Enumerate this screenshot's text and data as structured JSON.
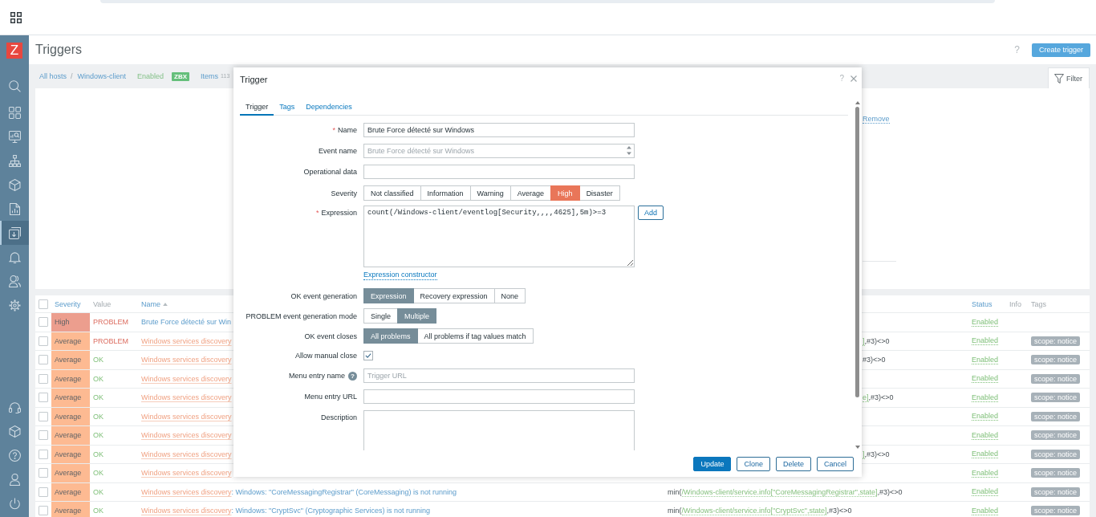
{
  "sidebar": {
    "logo": "Z",
    "items": [
      {
        "selected": false
      },
      {
        "selected": false
      },
      {
        "selected": false
      },
      {
        "selected": false
      },
      {
        "selected": false
      },
      {
        "selected": false
      },
      {
        "selected": true
      },
      {
        "selected": false
      },
      {
        "selected": false
      },
      {
        "selected": false
      }
    ],
    "bottom_items": [
      {
        "selected": false
      },
      {
        "selected": false
      },
      {
        "selected": false
      },
      {
        "selected": false
      },
      {
        "selected": false
      }
    ]
  },
  "header": {
    "title": "Triggers",
    "help": "?",
    "create_button": "Create trigger"
  },
  "breadcrumb": {
    "host_group": "All hosts",
    "separator": "/",
    "host": "Windows-client",
    "status": "Enabled",
    "badge": "ZBX",
    "items_label": "Items",
    "items_count": "113"
  },
  "filter": {
    "tab": {
      "label": "Filter",
      "expanded": true
    },
    "remove_link": "Remove"
  },
  "table": {
    "select_all_checked": false,
    "columns": [
      {
        "label": "Severity",
        "sortable": true,
        "sorted": false
      },
      {
        "label": "Value",
        "sortable": false,
        "sorted": false
      },
      {
        "label": "Name",
        "sortable": true,
        "sorted": true
      },
      {
        "label": "Status",
        "sortable": true,
        "sorted": false
      },
      {
        "label": "Info",
        "sortable": false,
        "sorted": false
      },
      {
        "label": "Tags",
        "sortable": false,
        "sorted": false
      }
    ],
    "rows": [
      {
        "checked": false,
        "severity": {
          "label": "High",
          "color": "#ec9e8e"
        },
        "value": {
          "label": "PROBLEM",
          "problem": true
        },
        "name": {
          "text": "Brute Force détecté sur Win"
        },
        "status": "Enabled"
      },
      {
        "checked": false,
        "severity": {
          "label": "Average",
          "color": "#fdba92"
        },
        "value": {
          "label": "PROBLEM",
          "problem": true
        },
        "name": {
          "discovery": "Windows services discovery"
        },
        "expression": {
          "key": "]",
          "rest": ",#3)<>0"
        },
        "status": "Enabled",
        "tags": [
          "scope: notice"
        ]
      },
      {
        "checked": false,
        "severity": {
          "label": "Average",
          "color": "#fdba92"
        },
        "value": {
          "label": "OK",
          "problem": false
        },
        "name": {
          "discovery": "Windows services discovery"
        },
        "expression": {
          "rest": "#3)<>0"
        },
        "status": "Enabled",
        "tags": [
          "scope: notice"
        ]
      },
      {
        "checked": false,
        "severity": {
          "label": "Average",
          "color": "#fdba92"
        },
        "value": {
          "label": "OK",
          "problem": false
        },
        "name": {
          "discovery": "Windows services discovery"
        },
        "status": "Enabled",
        "tags": [
          "scope: notice"
        ]
      },
      {
        "checked": false,
        "severity": {
          "label": "Average",
          "color": "#fdba92"
        },
        "value": {
          "label": "OK",
          "problem": false
        },
        "name": {
          "discovery": "Windows services discovery"
        },
        "expression": {
          "key": "e]",
          "rest": ",#3)<>0"
        },
        "status": "Enabled",
        "tags": [
          "scope: notice"
        ]
      },
      {
        "checked": false,
        "severity": {
          "label": "Average",
          "color": "#fdba92"
        },
        "value": {
          "label": "OK",
          "problem": false
        },
        "name": {
          "discovery": "Windows services discovery"
        },
        "status": "Enabled",
        "tags": [
          "scope: notice"
        ]
      },
      {
        "checked": false,
        "severity": {
          "label": "Average",
          "color": "#fdba92"
        },
        "value": {
          "label": "OK",
          "problem": false
        },
        "name": {
          "discovery": "Windows services discovery"
        },
        "status": "Enabled",
        "tags": [
          "scope: notice"
        ]
      },
      {
        "checked": false,
        "severity": {
          "label": "Average",
          "color": "#fdba92"
        },
        "value": {
          "label": "OK",
          "problem": false
        },
        "name": {
          "discovery": "Windows services discovery"
        },
        "expression": {
          "key": "]",
          "rest": ",#3)<>0"
        },
        "status": "Enabled",
        "tags": [
          "scope: notice"
        ]
      },
      {
        "checked": false,
        "severity": {
          "label": "Average",
          "color": "#fdba92"
        },
        "value": {
          "label": "OK",
          "problem": false
        },
        "name": {
          "discovery": "Windows services discovery"
        },
        "status": "Enabled",
        "tags": [
          "scope: notice"
        ]
      },
      {
        "checked": false,
        "severity": {
          "label": "Average",
          "color": "#fdba92"
        },
        "value": {
          "label": "OK",
          "problem": false
        },
        "name": {
          "discovery": "Windows services discovery",
          "text": ": Windows: \"CoreMessagingRegistrar\" (CoreMessaging) is not running"
        },
        "expression": {
          "func": "min(",
          "key": "/Windows-client/service.info[\"CoreMessagingRegistrar\",state]",
          "rest": ",#3)<>0"
        },
        "status": "Enabled",
        "tags": [
          "scope: notice"
        ]
      },
      {
        "checked": false,
        "severity": {
          "label": "Average",
          "color": "#fdba92"
        },
        "value": {
          "label": "OK",
          "problem": false
        },
        "name": {
          "discovery": "Windows services discovery",
          "text": ": Windows: \"CryptSvc\" (Cryptographic Services) is not running"
        },
        "expression": {
          "func": "min(",
          "key": "/Windows-client/service.info[\"CryptSvc\",state]",
          "rest": ",#3)<>0"
        },
        "status": "Enabled",
        "tags": [
          "scope: notice"
        ]
      }
    ]
  },
  "dialog": {
    "title": "Trigger",
    "help": "?",
    "tabs": [
      {
        "label": "Trigger",
        "selected": true
      },
      {
        "label": "Tags",
        "selected": false
      },
      {
        "label": "Dependencies",
        "selected": false
      }
    ],
    "fields": [
      {
        "kind": "input",
        "label": "Name",
        "required_mark": "*",
        "value": "Brute Force détecté sur Windows"
      },
      {
        "kind": "textbox",
        "label": "Event name",
        "placeholder": "Brute Force détecté sur Windows"
      },
      {
        "kind": "input",
        "label": "Operational data"
      },
      {
        "kind": "segmented",
        "label": "Severity",
        "options": [
          {
            "label": "Not classified",
            "selected": false
          },
          {
            "label": "Information",
            "selected": false
          },
          {
            "label": "Warning",
            "selected": false
          },
          {
            "label": "Average",
            "selected": false
          },
          {
            "label": "High",
            "selected": true,
            "color": "#e97659"
          },
          {
            "label": "Disaster",
            "selected": false
          }
        ]
      },
      {
        "kind": "expression",
        "label": "Expression",
        "required_mark": "*",
        "value": "count(/Windows-client/eventlog[Security,,,,4625],5m)>=3",
        "button": "Add",
        "link": "Expression constructor"
      },
      {
        "kind": "segmented",
        "label": "OK event generation",
        "options": [
          {
            "label": "Expression",
            "selected": true
          },
          {
            "label": "Recovery expression",
            "selected": false
          },
          {
            "label": "None",
            "selected": false
          }
        ]
      },
      {
        "kind": "segmented",
        "label": "PROBLEM event generation mode",
        "options": [
          {
            "label": "Single",
            "selected": false
          },
          {
            "label": "Multiple",
            "selected": true
          }
        ]
      },
      {
        "kind": "segmented",
        "label": "OK event closes",
        "options": [
          {
            "label": "All problems",
            "selected": true
          },
          {
            "label": "All problems if tag values match",
            "selected": false
          }
        ]
      },
      {
        "kind": "checkbox",
        "label": "Allow manual close",
        "checked": true
      },
      {
        "kind": "input",
        "label": "Menu entry name",
        "help": "?",
        "placeholder": "Trigger URL"
      },
      {
        "kind": "input",
        "label": "Menu entry URL"
      },
      {
        "kind": "textarea",
        "label": "Description"
      }
    ],
    "buttons": [
      {
        "label": "Update",
        "kind": "primary"
      },
      {
        "label": "Clone",
        "kind": "secondary"
      },
      {
        "label": "Delete",
        "kind": "secondary"
      },
      {
        "label": "Cancel",
        "kind": "secondary"
      }
    ]
  }
}
